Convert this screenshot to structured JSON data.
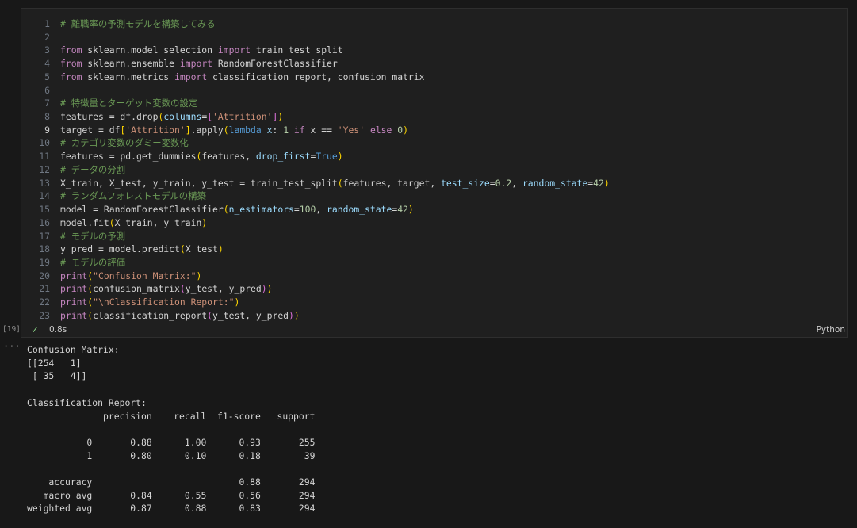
{
  "cell": {
    "execution_count": "[19]",
    "status_icon": "check-icon",
    "execution_time": "0.8s",
    "language": "Python",
    "current_line": 9,
    "lines": [
      [
        [
          "cm",
          "# 離職率の予測モデルを構築してみる"
        ]
      ],
      [],
      [
        [
          "kw",
          "from"
        ],
        [
          "pl",
          " sklearn.model_selection "
        ],
        [
          "kw",
          "import"
        ],
        [
          "pl",
          " train_test_split"
        ]
      ],
      [
        [
          "kw",
          "from"
        ],
        [
          "pl",
          " sklearn.ensemble "
        ],
        [
          "kw",
          "import"
        ],
        [
          "pl",
          " RandomForestClassifier"
        ]
      ],
      [
        [
          "kw",
          "from"
        ],
        [
          "pl",
          " sklearn.metrics "
        ],
        [
          "kw",
          "import"
        ],
        [
          "pl",
          " classification_report, confusion_matrix"
        ]
      ],
      [],
      [
        [
          "cm",
          "# 特徴量とターゲット変数の設定"
        ]
      ],
      [
        [
          "pl",
          "features = df.drop"
        ],
        [
          "br1",
          "("
        ],
        [
          "prm",
          "columns"
        ],
        [
          "pl",
          "="
        ],
        [
          "br2",
          "["
        ],
        [
          "str",
          "'Attrition'"
        ],
        [
          "br2",
          "]"
        ],
        [
          "br1",
          ")"
        ]
      ],
      [
        [
          "pl",
          "target = df"
        ],
        [
          "br1",
          "["
        ],
        [
          "str",
          "'Attrition'"
        ],
        [
          "br1",
          "]"
        ],
        [
          "pl",
          ".apply"
        ],
        [
          "br1",
          "("
        ],
        [
          "bool",
          "lambda"
        ],
        [
          "pl",
          " "
        ],
        [
          "prm",
          "x"
        ],
        [
          "pl",
          ": "
        ],
        [
          "num",
          "1"
        ],
        [
          "pl",
          " "
        ],
        [
          "kw",
          "if"
        ],
        [
          "pl",
          " x == "
        ],
        [
          "str",
          "'Yes'"
        ],
        [
          "pl",
          " "
        ],
        [
          "kw",
          "else"
        ],
        [
          "pl",
          " "
        ],
        [
          "num",
          "0"
        ],
        [
          "br1",
          ")"
        ]
      ],
      [
        [
          "cm",
          "# カテゴリ変数のダミー変数化"
        ]
      ],
      [
        [
          "pl",
          "features = pd.get_dummies"
        ],
        [
          "br1",
          "("
        ],
        [
          "pl",
          "features, "
        ],
        [
          "prm",
          "drop_first"
        ],
        [
          "pl",
          "="
        ],
        [
          "bool",
          "True"
        ],
        [
          "br1",
          ")"
        ]
      ],
      [
        [
          "cm",
          "# データの分割"
        ]
      ],
      [
        [
          "pl",
          "X_train, X_test, y_train, y_test = train_test_split"
        ],
        [
          "br1",
          "("
        ],
        [
          "pl",
          "features, target, "
        ],
        [
          "prm",
          "test_size"
        ],
        [
          "pl",
          "="
        ],
        [
          "num",
          "0.2"
        ],
        [
          "pl",
          ", "
        ],
        [
          "prm",
          "random_state"
        ],
        [
          "pl",
          "="
        ],
        [
          "num",
          "42"
        ],
        [
          "br1",
          ")"
        ]
      ],
      [
        [
          "cm",
          "# ランダムフォレストモデルの構築"
        ]
      ],
      [
        [
          "pl",
          "model = RandomForestClassifier"
        ],
        [
          "br1",
          "("
        ],
        [
          "prm",
          "n_estimators"
        ],
        [
          "pl",
          "="
        ],
        [
          "num",
          "100"
        ],
        [
          "pl",
          ", "
        ],
        [
          "prm",
          "random_state"
        ],
        [
          "pl",
          "="
        ],
        [
          "num",
          "42"
        ],
        [
          "br1",
          ")"
        ]
      ],
      [
        [
          "pl",
          "model.fit"
        ],
        [
          "br1",
          "("
        ],
        [
          "pl",
          "X_train, y_train"
        ],
        [
          "br1",
          ")"
        ]
      ],
      [
        [
          "cm",
          "# モデルの予測"
        ]
      ],
      [
        [
          "pl",
          "y_pred = model.predict"
        ],
        [
          "br1",
          "("
        ],
        [
          "pl",
          "X_test"
        ],
        [
          "br1",
          ")"
        ]
      ],
      [
        [
          "cm",
          "# モデルの評価"
        ]
      ],
      [
        [
          "kw",
          "print"
        ],
        [
          "br1",
          "("
        ],
        [
          "str",
          "\"Confusion Matrix:\""
        ],
        [
          "br1",
          ")"
        ]
      ],
      [
        [
          "kw",
          "print"
        ],
        [
          "br1",
          "("
        ],
        [
          "pl",
          "confusion_matrix"
        ],
        [
          "br2",
          "("
        ],
        [
          "pl",
          "y_test, y_pred"
        ],
        [
          "br2",
          ")"
        ],
        [
          "br1",
          ")"
        ]
      ],
      [
        [
          "kw",
          "print"
        ],
        [
          "br1",
          "("
        ],
        [
          "str",
          "\"\\nClassification Report:\""
        ],
        [
          "br1",
          ")"
        ]
      ],
      [
        [
          "kw",
          "print"
        ],
        [
          "br1",
          "("
        ],
        [
          "pl",
          "classification_report"
        ],
        [
          "br2",
          "("
        ],
        [
          "pl",
          "y_test, y_pred"
        ],
        [
          "br2",
          ")"
        ],
        [
          "br1",
          ")"
        ]
      ]
    ]
  },
  "output": {
    "menu_icon": "ellipsis-icon",
    "menu_label": "···",
    "text": "Confusion Matrix:\n[[254   1]\n [ 35   4]]\n\nClassification Report:\n              precision    recall  f1-score   support\n\n           0       0.88      1.00      0.93       255\n           1       0.80      0.10      0.18        39\n\n    accuracy                           0.88       294\n   macro avg       0.84      0.55      0.56       294\nweighted avg       0.87      0.88      0.83       294"
  }
}
